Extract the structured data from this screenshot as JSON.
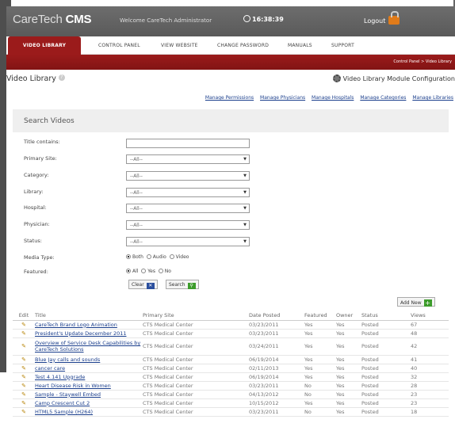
{
  "header": {
    "brand_prefix": "CareTech",
    "brand_strong": "CMS",
    "welcome": "Welcome CareTech Administrator",
    "clock": "16:38:39",
    "logout": "Logout"
  },
  "nav": [
    "VIDEO LIBRARY",
    "CONTROL PANEL",
    "VIEW WEBSITE",
    "CHANGE PASSWORD",
    "MANUALS",
    "SUPPORT"
  ],
  "breadcrumb": "Control Panel  >  Video Library",
  "page": {
    "title": "Video Library",
    "module_config": "Video Library Module Configuration"
  },
  "links": [
    "Manage Permissions",
    "Manage Physicians",
    "Manage Hospitals",
    "Manage Categories",
    "Manage Libraries"
  ],
  "search": {
    "header": "Search Videos",
    "title_label": "Title contains:",
    "title_value": "",
    "primary_site_label": "Primary Site:",
    "category_label": "Category:",
    "library_label": "Library:",
    "hospital_label": "Hospital:",
    "physician_label": "Physician:",
    "status_label": "Status:",
    "select_default": "--All--",
    "media_type_label": "Media Type:",
    "media_options": [
      "Both",
      "Audio",
      "Video"
    ],
    "featured_label": "Featured:",
    "featured_options": [
      "All",
      "Yes",
      "No"
    ],
    "clear_label": "Clear",
    "search_label": "Search"
  },
  "add_new_label": "Add New",
  "table": {
    "headers": [
      "Edit",
      "Title",
      "Primary Site",
      "Date Posted",
      "Featured",
      "Owner",
      "Status",
      "Views"
    ],
    "rows": [
      [
        "CareTech Brand Logo Animation",
        "CTS Medical Center",
        "03/23/2011",
        "Yes",
        "Yes",
        "Posted",
        "67"
      ],
      [
        "President's Update December 2011",
        "CTS Medical Center",
        "03/23/2011",
        "Yes",
        "Yes",
        "Posted",
        "48"
      ],
      [
        "Overview of Service Desk Capabilities by CareTech Solutions",
        "CTS Medical Center",
        "03/24/2011",
        "Yes",
        "Yes",
        "Posted",
        "42"
      ],
      [
        "Blue Jay calls and sounds",
        "CTS Medical Center",
        "06/19/2014",
        "Yes",
        "Yes",
        "Posted",
        "41"
      ],
      [
        "cancer care",
        "CTS Medical Center",
        "02/11/2013",
        "Yes",
        "Yes",
        "Posted",
        "40"
      ],
      [
        "Test 4.141 Upgrade",
        "CTS Medical Center",
        "06/19/2014",
        "Yes",
        "Yes",
        "Posted",
        "32"
      ],
      [
        "Heart Disease Risk in Women",
        "CTS Medical Center",
        "03/23/2011",
        "No",
        "Yes",
        "Posted",
        "28"
      ],
      [
        "Sample - Staywell Embed",
        "CTS Medical Center",
        "04/13/2012",
        "No",
        "Yes",
        "Posted",
        "23"
      ],
      [
        "Camp Crescent Cut 2",
        "CTS Medical Center",
        "10/15/2012",
        "Yes",
        "Yes",
        "Posted",
        "23"
      ],
      [
        "HTML5 Sample (H264)",
        "CTS Medical Center",
        "03/23/2011",
        "No",
        "Yes",
        "Posted",
        "18"
      ]
    ]
  }
}
